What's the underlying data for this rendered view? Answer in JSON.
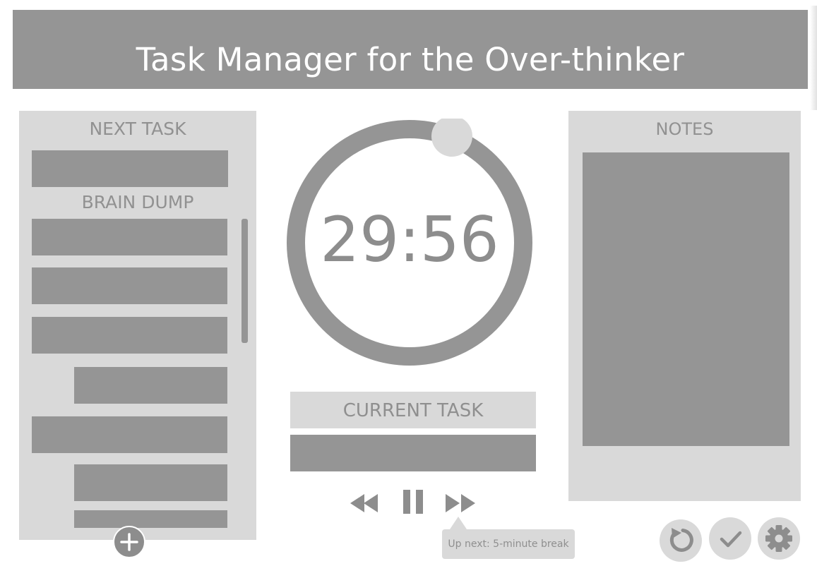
{
  "app": {
    "title": "Task Manager for the Over-thinker"
  },
  "left_panel": {
    "next_task_heading": "NEXT TASK",
    "brain_dump_heading": "BRAIN DUMP",
    "add_icon": "plus-icon"
  },
  "timer": {
    "time": "29:56",
    "progress": 0.01
  },
  "current_task": {
    "label": "CURRENT TASK"
  },
  "controls": {
    "rewind_icon": "rewind-icon",
    "pause_icon": "pause-icon",
    "fast_forward_icon": "fast-forward-icon",
    "tooltip": "Up next: 5-minute break"
  },
  "notes": {
    "heading": "NOTES"
  },
  "actions": {
    "reset_icon": "reset-icon",
    "complete_icon": "checkmark-icon",
    "settings_icon": "gear-icon"
  },
  "colors": {
    "dark": "#959595",
    "light": "#d9d9d9",
    "white": "#ffffff"
  }
}
